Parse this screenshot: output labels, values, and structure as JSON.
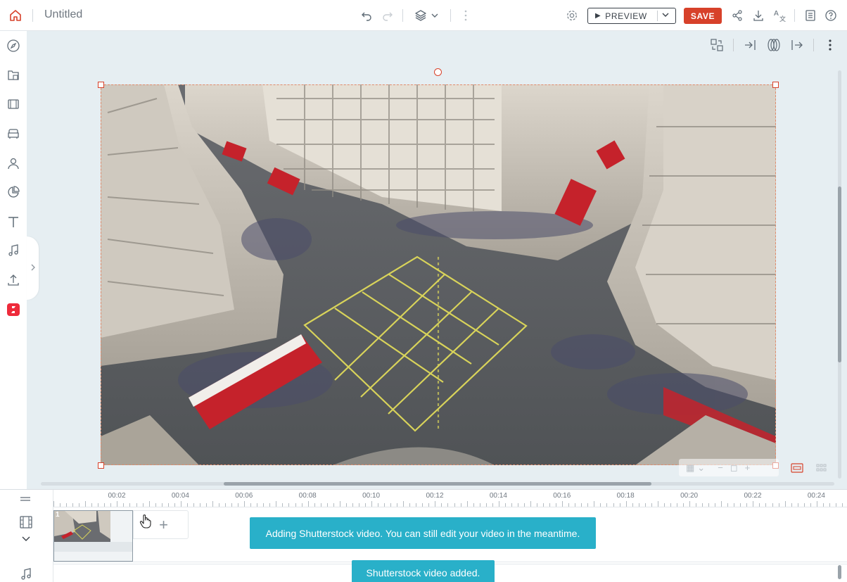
{
  "topbar": {
    "title": "Untitled",
    "preview_label": "PREVIEW",
    "save_label": "SAVE"
  },
  "sidebar": {
    "items": [
      {
        "icon": "compass-icon"
      },
      {
        "icon": "media-library-icon"
      },
      {
        "icon": "film-icon"
      },
      {
        "icon": "furniture-icon"
      },
      {
        "icon": "person-icon"
      },
      {
        "icon": "pie-chart-icon"
      },
      {
        "icon": "text-icon"
      },
      {
        "icon": "music-icon"
      },
      {
        "icon": "upload-icon"
      },
      {
        "icon": "shutterstock-icon"
      }
    ]
  },
  "timeline": {
    "ruler_labels": [
      "00:02",
      "00:04",
      "00:06",
      "00:08",
      "00:10",
      "00:12",
      "00:14",
      "00:16",
      "00:18",
      "00:20",
      "00:22",
      "00:24"
    ],
    "clip_number": "1",
    "add_symbol": "+"
  },
  "toasts": {
    "adding": "Adding Shutterstock video. You can still edit your video in the meantime.",
    "added": "Shutterstock video added."
  },
  "colors": {
    "accent": "#d7412a",
    "toast": "#29b0c9",
    "canvas_bg": "#e6eef2"
  }
}
